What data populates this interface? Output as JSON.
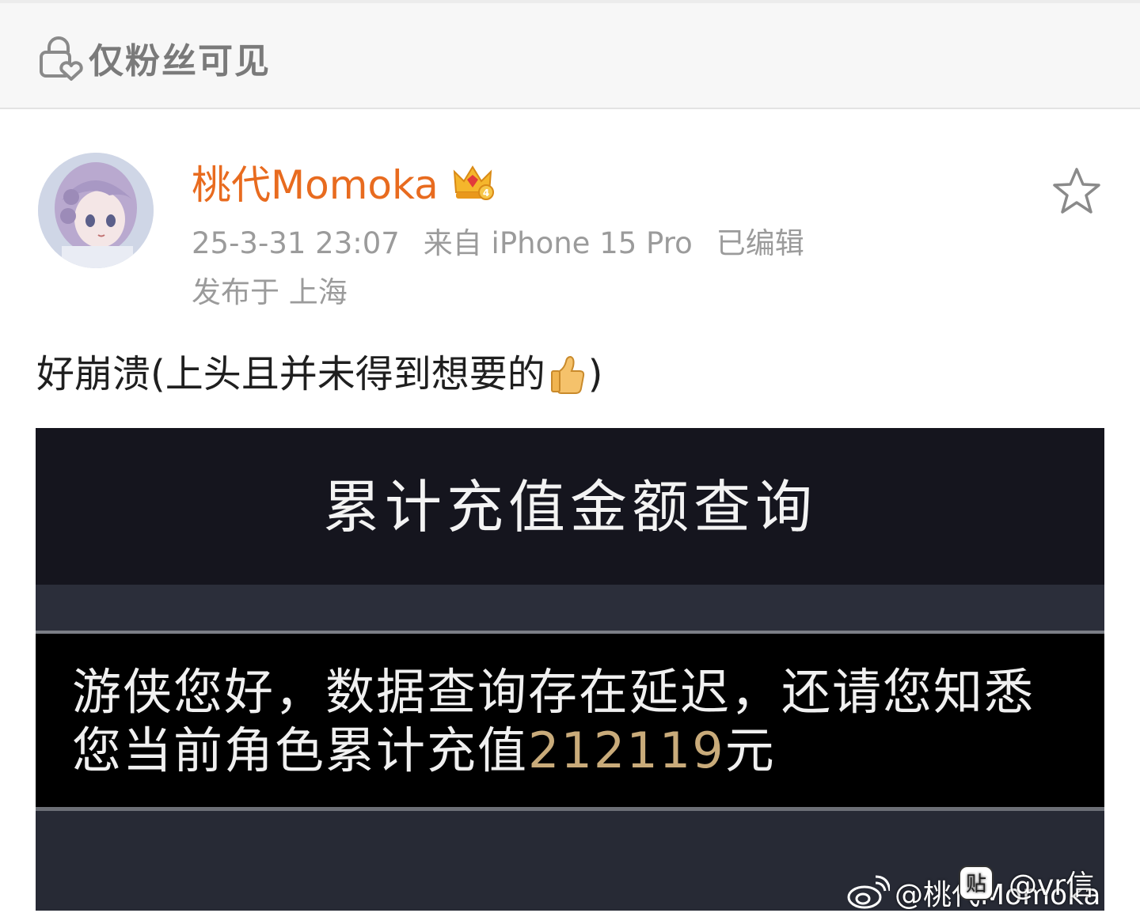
{
  "visibility": {
    "label": "仅粉丝可见",
    "icon": "lock-heart-icon"
  },
  "post": {
    "username": "桃代Momoka",
    "badge_icon": "crown-icon",
    "timestamp": "25-3-31 23:07",
    "source": "来自 iPhone 15 Pro",
    "edited": "已编辑",
    "location": "发布于 上海",
    "text_before_emoji": "好崩溃(上头且并未得到想要的",
    "emoji_icon": "thumbs-up-icon",
    "text_after_emoji": ")"
  },
  "image": {
    "title": "累计充值金额查询",
    "message_line1": "游侠您好，数据查询存在延迟，还请您知悉",
    "message_line2_prefix": "您当前角色累计充值",
    "amount": "212119",
    "message_line2_suffix": "元"
  },
  "watermarks": {
    "weibo": "@桃代Momoka",
    "tieba": "@vr信"
  },
  "colors": {
    "username": "#e86b1f",
    "meta": "#9b9b9b",
    "amount": "#c9ab7a",
    "image_bg": "#16161f"
  }
}
